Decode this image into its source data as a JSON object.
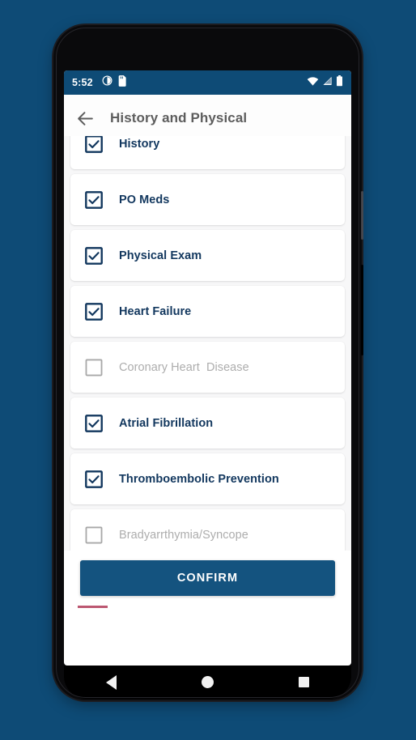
{
  "theme": {
    "page_background": "#0e4b76",
    "status_bar_color": "#0e4b76",
    "accent": "#14537f",
    "checked_text_color": "#12375e",
    "unchecked_text_color": "#adadad",
    "list_background": "#f7f7f8"
  },
  "status_bar": {
    "time": "5:52",
    "notification_icons": [
      "clock-icon",
      "sd-card-icon"
    ],
    "system_icons": [
      "wifi-icon",
      "cell-signal-icon",
      "battery-icon"
    ]
  },
  "app_bar": {
    "back_icon": "arrow-left-icon",
    "title": "History and Physical"
  },
  "checklist": {
    "items": [
      {
        "label": "History",
        "checked": true
      },
      {
        "label": "PO Meds",
        "checked": true
      },
      {
        "label": "Physical Exam",
        "checked": true
      },
      {
        "label": "Heart Failure",
        "checked": true
      },
      {
        "label": "Coronary Heart  Disease",
        "checked": false
      },
      {
        "label": "Atrial Fibrillation",
        "checked": true
      },
      {
        "label": "Thromboembolic Prevention",
        "checked": true
      },
      {
        "label": "Bradyarrthymia/Syncope",
        "checked": false
      }
    ]
  },
  "footer": {
    "confirm_label": "CONFIRM"
  },
  "nav_bar": {
    "buttons": [
      "back-icon",
      "home-icon",
      "recents-icon"
    ]
  }
}
